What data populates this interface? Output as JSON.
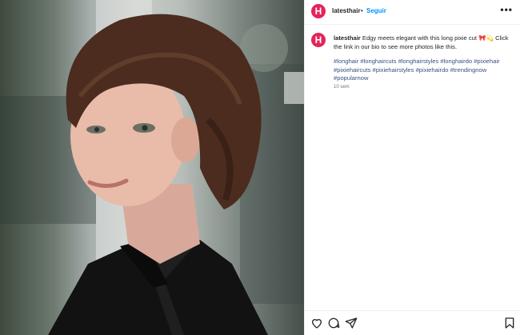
{
  "post": {
    "image_alt": "Woman with a long pixie haircut in a black shirt",
    "username": "latesthair",
    "separator": "•",
    "follow_label": "Seguir",
    "more_icon": "more-dots-icon",
    "avatar_letter": "H",
    "caption_user": "latesthair",
    "caption_text": "Edgy meets elegant with this long pixie cut 🎀💫 Click the link in our bio to see more photos like this.",
    "hashtags": "#longhair #longhaircuts #longhairstyles #longhairdo #pixiehair #pixiehaircuts #pixiehairstyles #pixiehairdo #trendingnow #popularnow",
    "timestamp": "10 sem",
    "actions": [
      "heart-icon",
      "comment-icon",
      "share-icon",
      "bookmark-icon"
    ],
    "colors": {
      "brand": "#e4245a",
      "follow": "#0095f6",
      "hashtag": "#385185"
    }
  }
}
